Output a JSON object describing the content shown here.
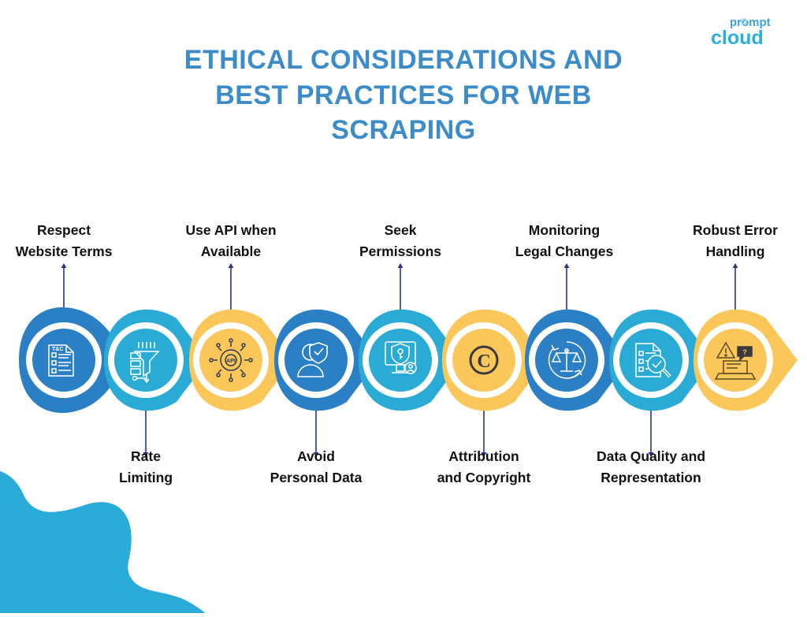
{
  "brand": {
    "logo_top": "prompt",
    "logo_bottom": "cloud",
    "logo_color_top": "#3aa3dc",
    "logo_color_bottom": "#29b0e0"
  },
  "title": {
    "line1": "ETHICAL CONSIDERATIONS AND",
    "line2": "BEST PRACTICES FOR WEB",
    "line3": "SCRAPING",
    "color": "#3d8cca"
  },
  "palette": {
    "dark_blue": "#2b7fc5",
    "light_blue": "#29abd6",
    "yellow": "#fbc75b",
    "connector": "#27348b",
    "blob": "#2bacd8",
    "label_text": "#111111",
    "white": "#ffffff"
  },
  "flow": {
    "steps": [
      {
        "index": 1,
        "label_line1": "Respect",
        "label_line2": "Website Terms",
        "position": "top",
        "color": "dark_blue",
        "icon": "terms-document-icon"
      },
      {
        "index": 2,
        "label_line1": "Rate",
        "label_line2": "Limiting",
        "position": "bottom",
        "color": "light_blue",
        "icon": "rate-limit-funnel-icon"
      },
      {
        "index": 3,
        "label_line1": "Use API when",
        "label_line2": "Available",
        "position": "top",
        "color": "yellow",
        "icon": "api-gear-icon"
      },
      {
        "index": 4,
        "label_line1": "Avoid",
        "label_line2": "Personal Data",
        "position": "bottom",
        "color": "dark_blue",
        "icon": "person-shield-icon"
      },
      {
        "index": 5,
        "label_line1": "Seek",
        "label_line2": "Permissions",
        "position": "top",
        "color": "light_blue",
        "icon": "monitor-shield-key-icon"
      },
      {
        "index": 6,
        "label_line1": "Attribution",
        "label_line2": "and Copyright",
        "position": "bottom",
        "color": "yellow",
        "icon": "copyright-icon"
      },
      {
        "index": 7,
        "label_line1": "Monitoring",
        "label_line2": "Legal Changes",
        "position": "top",
        "color": "dark_blue",
        "icon": "legal-scales-refresh-icon"
      },
      {
        "index": 8,
        "label_line1": "Data Quality and",
        "label_line2": "Representation",
        "position": "bottom",
        "color": "light_blue",
        "icon": "checklist-magnifier-icon"
      },
      {
        "index": 9,
        "label_line1": "Robust Error",
        "label_line2": "Handling",
        "position": "top",
        "color": "yellow",
        "icon": "error-warning-laptop-icon"
      }
    ]
  }
}
